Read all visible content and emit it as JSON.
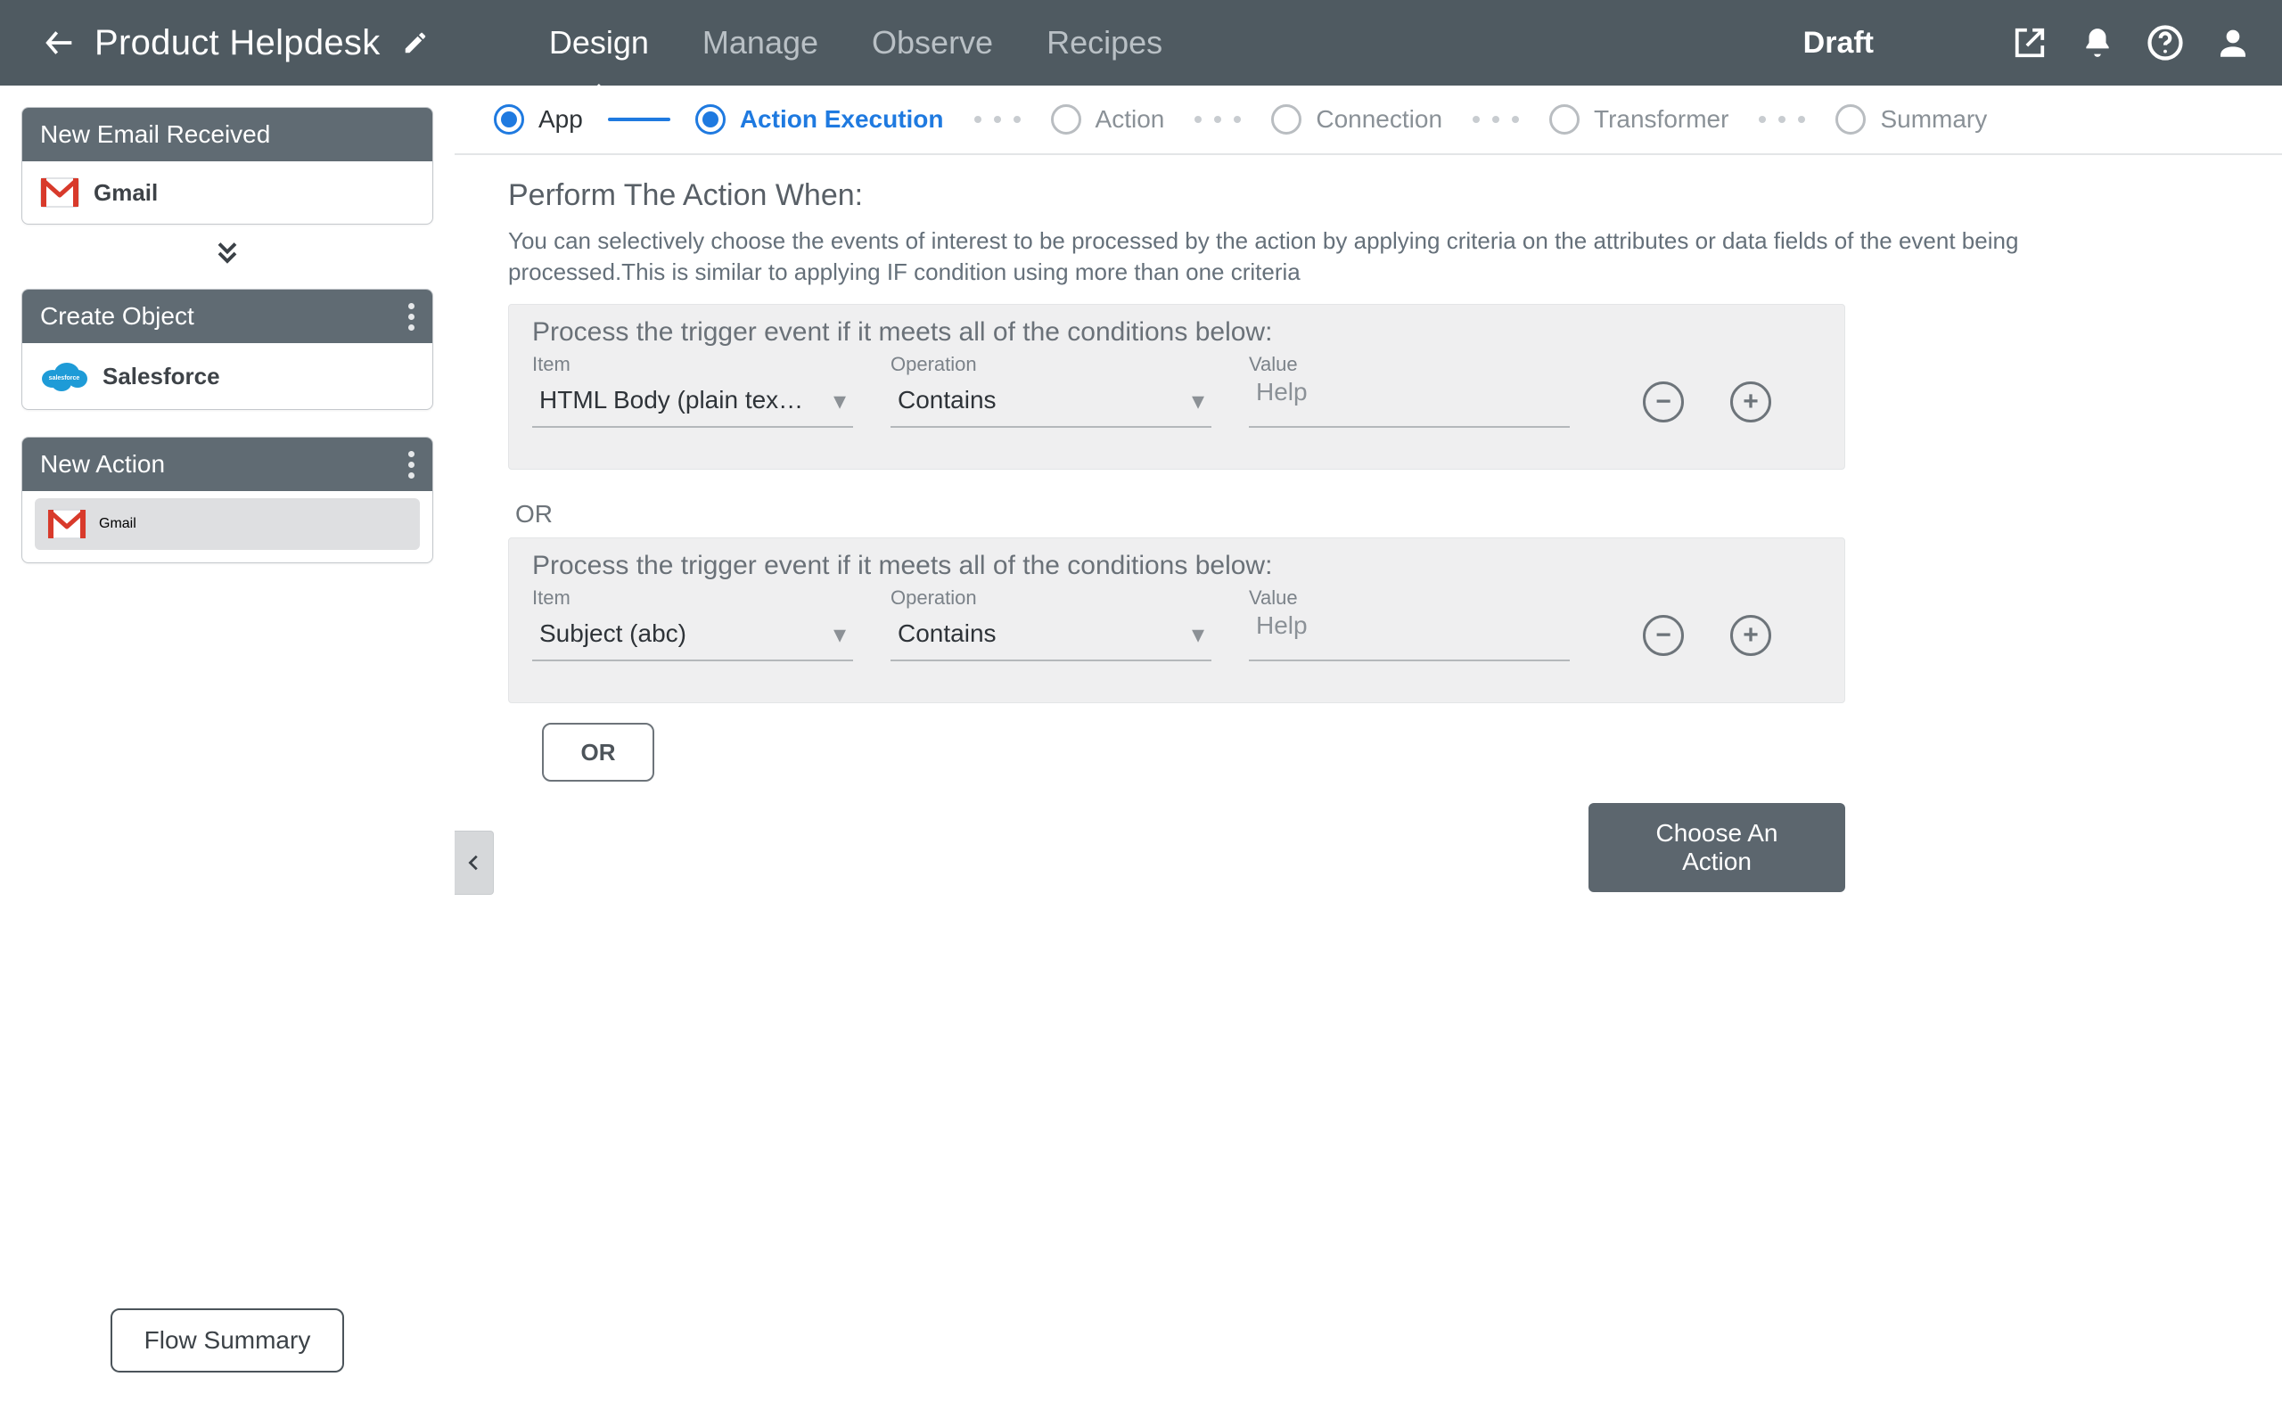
{
  "header": {
    "title": "Product Helpdesk",
    "tabs": [
      "Design",
      "Manage",
      "Observe",
      "Recipes"
    ],
    "active_tab": 0,
    "status": "Draft"
  },
  "sidebar": {
    "cards": [
      {
        "title": "New Email Received",
        "provider": "Gmail",
        "kind": "gmail",
        "menu": false,
        "selected": false
      },
      {
        "title": "Create Object",
        "provider": "Salesforce",
        "kind": "salesforce",
        "menu": true,
        "selected": false
      },
      {
        "title": "New Action",
        "provider": "Gmail",
        "kind": "gmail",
        "menu": true,
        "selected": true
      }
    ],
    "flow_summary": "Flow Summary"
  },
  "steps": {
    "items": [
      {
        "label": "App",
        "state": "done"
      },
      {
        "label": "Action Execution",
        "state": "active"
      },
      {
        "label": "Action",
        "state": "todo"
      },
      {
        "label": "Connection",
        "state": "todo"
      },
      {
        "label": "Transformer",
        "state": "todo"
      },
      {
        "label": "Summary",
        "state": "todo"
      }
    ]
  },
  "panel": {
    "heading": "Perform The Action When:",
    "description": "You can selectively choose the events of interest to be processed by the action by applying criteria on the attributes or data fields of the event being processed.This is similar to applying IF condition using more than one criteria",
    "group_title": "Process the trigger event if it meets all of the conditions below:",
    "labels": {
      "item": "Item",
      "operation": "Operation",
      "value": "Value"
    },
    "or": "OR",
    "groups": [
      {
        "item": "HTML Body (plain tex…",
        "operation": "Contains",
        "value": "Help"
      },
      {
        "item": "Subject (abc)",
        "operation": "Contains",
        "value": "Help"
      }
    ],
    "add_or": "OR",
    "choose_action": "Choose An Action"
  }
}
